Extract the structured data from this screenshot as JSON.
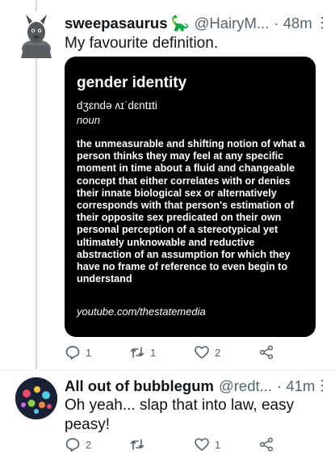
{
  "tweets": [
    {
      "name": "sweepasaurus",
      "emoji": "🦕",
      "handle": "@HairyM...",
      "time": "· 48m",
      "more": "⋮",
      "text": "My favourite definition.",
      "card": {
        "word": "gender identity",
        "pronunciation": "dʒɛndə ʌɪˈdɛntɪti",
        "part_of_speech": "noun",
        "definition": "the unmeasurable and shifting notion of what a person thinks they may feel at any specific moment in time about a fluid and changeable concept that either correlates with or denies their innate biological sex or alternatively corresponds with that person's estimation of their opposite sex predicated on their own personal perception of a stereotypical yet ultimately unknowable and reductive abstraction of an assumption for which they have no frame of reference to even begin to understand",
        "source": "youtube.com/thestatemedia"
      },
      "actions": {
        "replies": "1",
        "retweets": "1",
        "likes": "2"
      }
    },
    {
      "name": "All out of bubblegum",
      "handle": "@redt...",
      "time": "· 41m",
      "more": "⋮",
      "text": "Oh yeah... slap that into law, easy peasy!",
      "actions": {
        "replies": "2",
        "retweets": "",
        "likes": "1"
      }
    }
  ],
  "colors": {
    "secondary": "#536471",
    "card_bg": "#000000",
    "thread_line": "#cfd9de"
  }
}
